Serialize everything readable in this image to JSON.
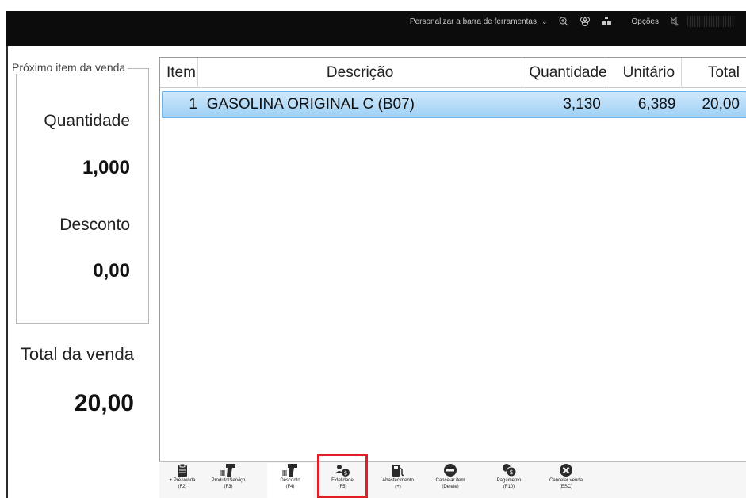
{
  "toolbar": {
    "customize_label": "Personalizar a barra de ferramentas",
    "options_label": "Opções",
    "icons": [
      "chevron-down-icon",
      "zoom-in-icon",
      "filter-icon",
      "network-icon",
      "mute-icon"
    ]
  },
  "side": {
    "legend": "Próximo item da venda",
    "quantity_label": "Quantidade",
    "quantity_value": "1,000",
    "discount_label": "Desconto",
    "discount_value": "0,00",
    "total_label": "Total da venda",
    "total_value": "20,00"
  },
  "table": {
    "headers": [
      "Item",
      "Descrição",
      "Quantidade",
      "Unitário",
      "Total"
    ],
    "rows": [
      {
        "item": "1",
        "description": "GASOLINA ORIGINAL C (B07)",
        "quantity": "3,130",
        "unit": "6,389",
        "total": "20,00"
      }
    ]
  },
  "actions": [
    {
      "label": "+ Pré-venda",
      "key": "(F2)",
      "icon": "clipboard-icon"
    },
    {
      "label": "Produto/Serviço",
      "key": "(F3)",
      "icon": "barcode-scanner-icon"
    },
    {
      "label": "Desconto",
      "key": "(F4)",
      "icon": "barcode-scanner-icon"
    },
    {
      "label": "Fidelidade",
      "key": "(F5)",
      "icon": "loyalty-icon"
    },
    {
      "label": "Abastecimento",
      "key": "(+)",
      "icon": "fuel-pump-icon"
    },
    {
      "label": "Cancelar item",
      "key": "(Delete)",
      "icon": "minus-circle-icon"
    },
    {
      "label": "Pagamento",
      "key": "(F10)",
      "icon": "coins-icon"
    },
    {
      "label": "Cancelar venda",
      "key": "(ESC)",
      "icon": "cancel-circle-icon"
    }
  ],
  "colors": {
    "selected_row": "#9fd0f5",
    "highlight_border": "#e11d2a",
    "top_bar": "#0c0c0c"
  }
}
